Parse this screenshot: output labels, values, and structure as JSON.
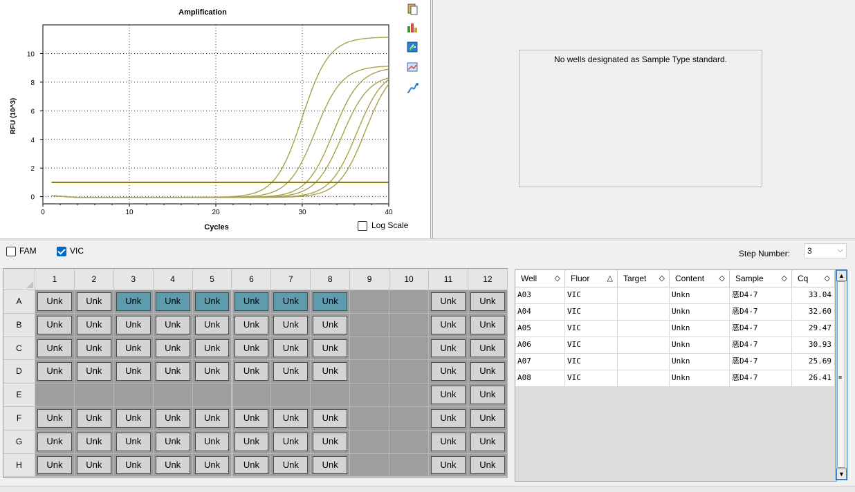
{
  "chart": {
    "title": "Amplification",
    "xlabel": "Cycles",
    "ylabel": "RFU (10^3)",
    "log_scale_label": "Log Scale",
    "log_scale_checked": false
  },
  "chart_data": {
    "type": "line",
    "title": "Amplification",
    "xlabel": "Cycles",
    "ylabel": "RFU (10^3)",
    "xlim": [
      0,
      40
    ],
    "ylim": [
      -0.5,
      12
    ],
    "x_ticks": [
      0,
      10,
      20,
      30,
      40
    ],
    "y_ticks": [
      0,
      2,
      4,
      6,
      8,
      10
    ],
    "grid": true,
    "line_color": "#a8a04a",
    "threshold": {
      "value": 1.0,
      "color": "#7a7400"
    },
    "series": [
      {
        "midpoint": 30.0,
        "plateau": 11.2
      },
      {
        "midpoint": 31.5,
        "plateau": 9.2
      },
      {
        "midpoint": 33.6,
        "plateau": 9.1
      },
      {
        "midpoint": 34.6,
        "plateau": 8.6
      },
      {
        "midpoint": 36.3,
        "plateau": 9.0
      },
      {
        "midpoint": 37.3,
        "plateau": 9.3
      }
    ]
  },
  "standard": {
    "message": "No wells designated as Sample Type standard."
  },
  "fluors": [
    {
      "label": "FAM",
      "checked": false
    },
    {
      "label": "VIC",
      "checked": true
    }
  ],
  "step": {
    "label": "Step Number:",
    "value": "3"
  },
  "plate": {
    "columns": [
      "1",
      "2",
      "3",
      "4",
      "5",
      "6",
      "7",
      "8",
      "9",
      "10",
      "11",
      "12"
    ],
    "rows": [
      "A",
      "B",
      "C",
      "D",
      "E",
      "F",
      "G",
      "H"
    ],
    "well_label": "Unk",
    "selected": [
      "A3",
      "A4",
      "A5",
      "A6",
      "A7",
      "A8"
    ],
    "empty_columns": [
      "9",
      "10"
    ],
    "empty_rows": [
      "E"
    ],
    "colors": {
      "selected": "#5d9bad",
      "well": "#d4d4d4",
      "empty": "#9e9e9e"
    }
  },
  "table": {
    "headers": [
      {
        "label": "Well",
        "sort": "◇"
      },
      {
        "label": "Fluor",
        "sort": "△"
      },
      {
        "label": "Target",
        "sort": "◇"
      },
      {
        "label": "Content",
        "sort": "◇"
      },
      {
        "label": "Sample",
        "sort": "◇"
      },
      {
        "label": "Cq",
        "sort": "◇"
      }
    ],
    "rows": [
      [
        "A03",
        "VIC",
        "",
        "Unkn",
        "恶D4-7",
        "33.04"
      ],
      [
        "A04",
        "VIC",
        "",
        "Unkn",
        "恶D4-7",
        "32.60"
      ],
      [
        "A05",
        "VIC",
        "",
        "Unkn",
        "恶D4-7",
        "29.47"
      ],
      [
        "A06",
        "VIC",
        "",
        "Unkn",
        "恶D4-7",
        "30.93"
      ],
      [
        "A07",
        "VIC",
        "",
        "Unkn",
        "恶D4-7",
        "25.69"
      ],
      [
        "A08",
        "VIC",
        "",
        "Unkn",
        "恶D4-7",
        "26.41"
      ]
    ]
  },
  "toolbar_icons": [
    "copy-icon",
    "chart-settings-icon",
    "export-icon",
    "image-icon",
    "trace-icon"
  ]
}
